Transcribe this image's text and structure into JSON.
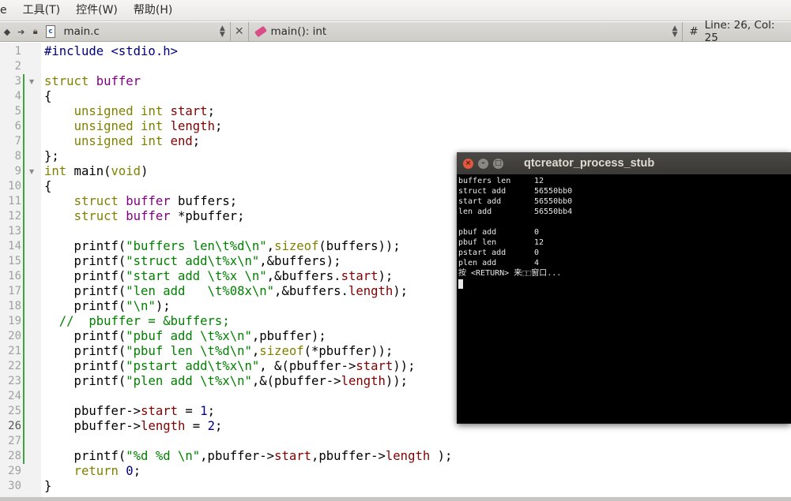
{
  "menu": {
    "items": [
      "e",
      "工具(T)",
      "控件(W)",
      "帮助(H)"
    ]
  },
  "toolbar": {
    "file_name": "main.c",
    "file_icon_letter": "c",
    "function": "main(): int",
    "hash": "#",
    "position": "Line: 26, Col: 25"
  },
  "editor": {
    "current_line": 26,
    "lines": [
      [
        [
          "pp",
          "#include <stdio.h>"
        ]
      ],
      [],
      [
        [
          "kw",
          "struct"
        ],
        [
          "n",
          " "
        ],
        [
          "kb",
          "buffer"
        ]
      ],
      [
        [
          "n",
          "{"
        ]
      ],
      [
        [
          "n",
          "    "
        ],
        [
          "kw",
          "unsigned int"
        ],
        [
          "n",
          " "
        ],
        [
          "fd",
          "start"
        ],
        [
          "n",
          ";"
        ]
      ],
      [
        [
          "n",
          "    "
        ],
        [
          "kw",
          "unsigned int"
        ],
        [
          "n",
          " "
        ],
        [
          "fd",
          "length"
        ],
        [
          "n",
          ";"
        ]
      ],
      [
        [
          "n",
          "    "
        ],
        [
          "kw",
          "unsigned int"
        ],
        [
          "n",
          " "
        ],
        [
          "fd",
          "end"
        ],
        [
          "n",
          ";"
        ]
      ],
      [
        [
          "n",
          "};"
        ]
      ],
      [
        [
          "kw",
          "int"
        ],
        [
          "n",
          " main("
        ],
        [
          "kw",
          "void"
        ],
        [
          "n",
          ")"
        ]
      ],
      [
        [
          "n",
          "{"
        ]
      ],
      [
        [
          "n",
          "    "
        ],
        [
          "kw",
          "struct"
        ],
        [
          "n",
          " "
        ],
        [
          "kb",
          "buffer"
        ],
        [
          "n",
          " buffers;"
        ]
      ],
      [
        [
          "n",
          "    "
        ],
        [
          "kw",
          "struct"
        ],
        [
          "n",
          " "
        ],
        [
          "kb",
          "buffer"
        ],
        [
          "n",
          " *pbuffer;"
        ]
      ],
      [],
      [
        [
          "n",
          "    printf("
        ],
        [
          "st",
          "\"buffers len\\t%d\\n\""
        ],
        [
          "n",
          ","
        ],
        [
          "kw",
          "sizeof"
        ],
        [
          "n",
          "(buffers));"
        ]
      ],
      [
        [
          "n",
          "    printf("
        ],
        [
          "st",
          "\"struct add\\t%x\\n\""
        ],
        [
          "n",
          ",&buffers);"
        ]
      ],
      [
        [
          "n",
          "    printf("
        ],
        [
          "st",
          "\"start add \\t%x \\n\""
        ],
        [
          "n",
          ",&buffers."
        ],
        [
          "fd",
          "start"
        ],
        [
          "n",
          ");"
        ]
      ],
      [
        [
          "n",
          "    printf("
        ],
        [
          "st",
          "\"len add   \\t%08x\\n\""
        ],
        [
          "n",
          ",&buffers."
        ],
        [
          "fd",
          "length"
        ],
        [
          "n",
          ");"
        ]
      ],
      [
        [
          "n",
          "    printf("
        ],
        [
          "st",
          "\"\\n\""
        ],
        [
          "n",
          ");"
        ]
      ],
      [
        [
          "cm",
          "  //  pbuffer = &buffers;"
        ]
      ],
      [
        [
          "n",
          "    printf("
        ],
        [
          "st",
          "\"pbuf add \\t%x\\n\""
        ],
        [
          "n",
          ",pbuffer);"
        ]
      ],
      [
        [
          "n",
          "    printf("
        ],
        [
          "st",
          "\"pbuf len \\t%d\\n\""
        ],
        [
          "n",
          ","
        ],
        [
          "kw",
          "sizeof"
        ],
        [
          "n",
          "(*pbuffer));"
        ]
      ],
      [
        [
          "n",
          "    printf("
        ],
        [
          "st",
          "\"pstart add\\t%x\\n\""
        ],
        [
          "n",
          ", &(pbuffer->"
        ],
        [
          "fd",
          "start"
        ],
        [
          "n",
          "));"
        ]
      ],
      [
        [
          "n",
          "    printf("
        ],
        [
          "st",
          "\"plen add \\t%x\\n\""
        ],
        [
          "n",
          ",&(pbuffer->"
        ],
        [
          "fd",
          "length"
        ],
        [
          "n",
          "));"
        ]
      ],
      [],
      [
        [
          "n",
          "    pbuffer->"
        ],
        [
          "fd",
          "start"
        ],
        [
          "n",
          " = "
        ],
        [
          "nm",
          "1"
        ],
        [
          "n",
          ";"
        ]
      ],
      [
        [
          "n",
          "    pbuffer->"
        ],
        [
          "fd",
          "length"
        ],
        [
          "n",
          " = "
        ],
        [
          "nm",
          "2"
        ],
        [
          "n",
          ";"
        ]
      ],
      [],
      [
        [
          "n",
          "    printf("
        ],
        [
          "st",
          "\"%d %d \\n\""
        ],
        [
          "n",
          ",pbuffer->"
        ],
        [
          "fd",
          "start"
        ],
        [
          "n",
          ",pbuffer->"
        ],
        [
          "fd",
          "length"
        ],
        [
          "n",
          " );"
        ]
      ],
      [
        [
          "n",
          "    "
        ],
        [
          "kw",
          "return"
        ],
        [
          "n",
          " "
        ],
        [
          "nm",
          "0"
        ],
        [
          "n",
          ";"
        ]
      ],
      [
        [
          "n",
          "}"
        ]
      ]
    ]
  },
  "terminal": {
    "title": "qtcreator_process_stub",
    "buttons": [
      "×",
      "–",
      "□"
    ],
    "rows": [
      [
        "buffers len",
        "12"
      ],
      [
        "struct add",
        "56550bb0"
      ],
      [
        "start add",
        "56550bb0"
      ],
      [
        "len add",
        "56550bb4"
      ],
      [
        "",
        ""
      ],
      [
        "pbuf add",
        "0"
      ],
      [
        "pbuf len",
        "12"
      ],
      [
        "pstart add",
        "0"
      ],
      [
        "plen add",
        "4"
      ]
    ],
    "prompt": "按 <RETURN> 来⬚⬚窗口..."
  }
}
